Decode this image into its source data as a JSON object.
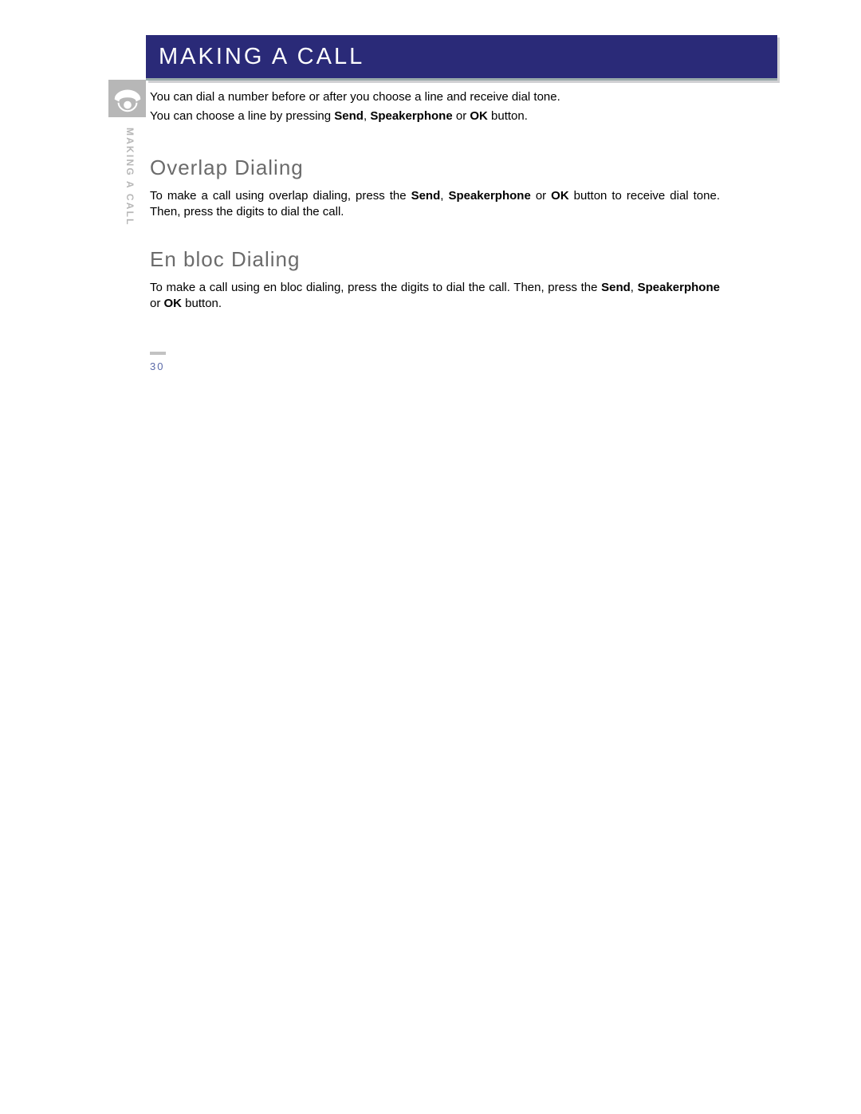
{
  "header": {
    "title": "MAKING A CALL"
  },
  "sidebar": {
    "label": "MAKING A CALL",
    "icon": "phone-handset-icon"
  },
  "intro": {
    "line1_pre": "You can dial a number before or after you choose a line and receive dial tone.",
    "line2_pre": "You can choose a line by pressing ",
    "line2_b1": "Send",
    "line2_mid1": ", ",
    "line2_b2": "Speakerphone",
    "line2_mid2": " or ",
    "line2_b3": "OK",
    "line2_post": " button."
  },
  "section1": {
    "heading": "Overlap Dialing",
    "text_pre": "To make a call using overlap dialing, press the ",
    "b1": "Send",
    "mid1": ", ",
    "b2": "Speakerphone",
    "mid2": " or ",
    "b3": "OK",
    "text_post": " button to receive dial tone.   Then, press the digits to dial the call."
  },
  "section2": {
    "heading": "En bloc Dialing",
    "text_pre": "To make a call using en bloc dialing, press the digits to dial the call. Then, press the ",
    "b1": "Send",
    "mid1": ", ",
    "b2": "Speakerphone",
    "mid2": " or ",
    "b3": "OK",
    "text_post": " button."
  },
  "page_number": "30"
}
